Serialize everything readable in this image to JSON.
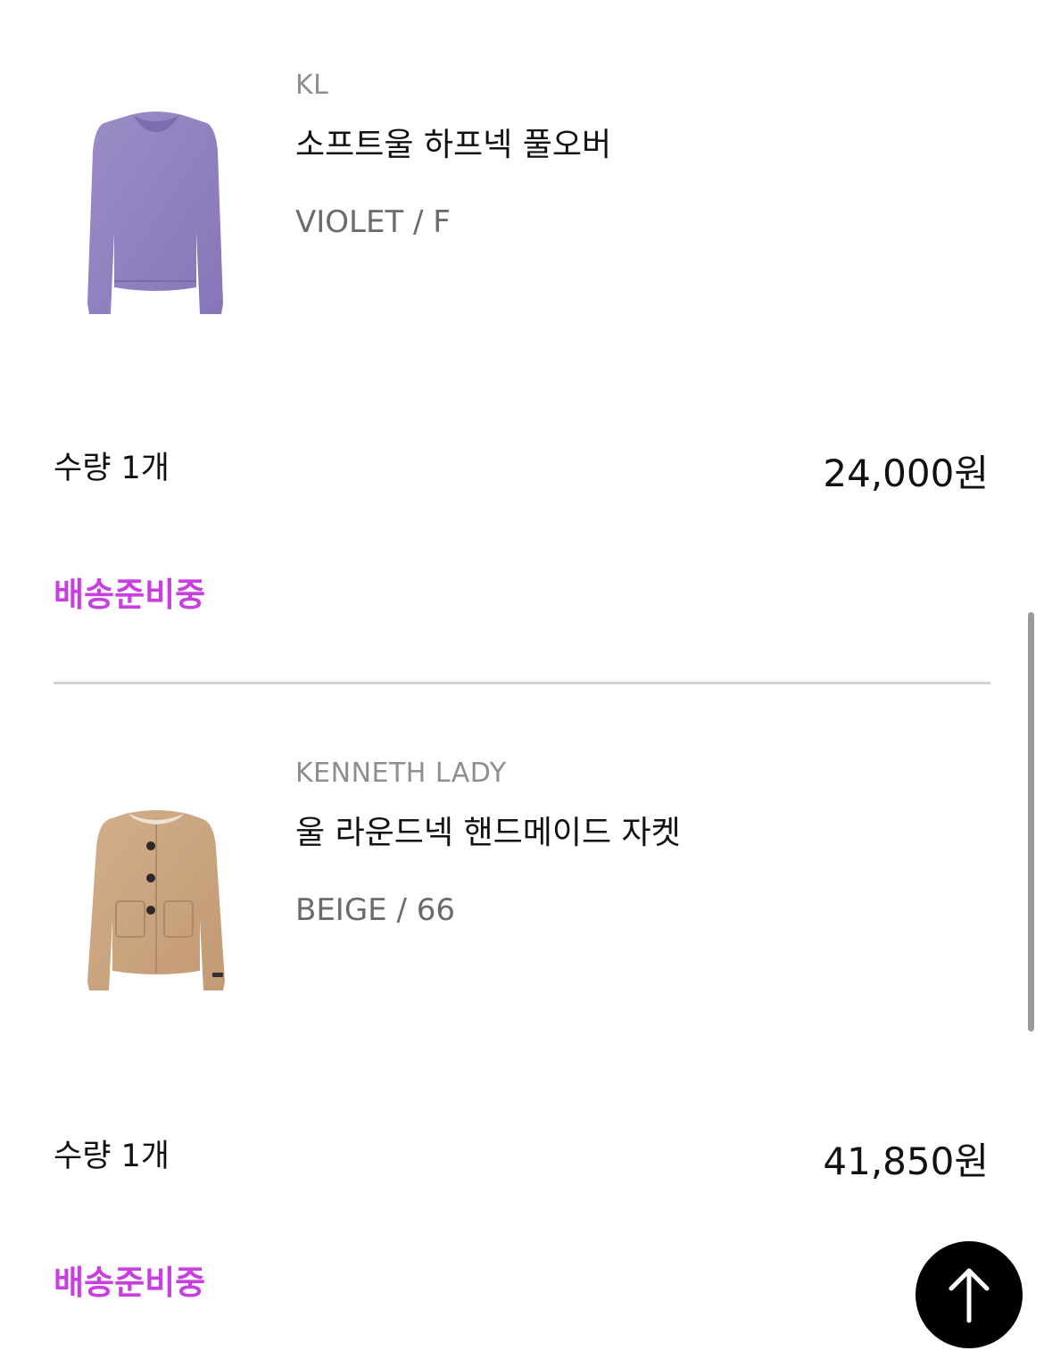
{
  "items": [
    {
      "brand": "KL",
      "name": "소프트울 하프넥 풀오버",
      "option": "VIOLET / F",
      "quantity": "수량 1개",
      "price": "24,000원",
      "status": "배송준비중",
      "image": "violet-sweater"
    },
    {
      "brand": "KENNETH LADY",
      "name": "울 라운드넥 핸드메이드 자켓",
      "option": "BEIGE / 66",
      "quantity": "수량 1개",
      "price": "41,850원",
      "status": "배송준비중",
      "image": "beige-jacket"
    }
  ],
  "colors": {
    "status": "#c93ee0",
    "divider": "#d4d4d4",
    "brand": "#8e8e8e"
  },
  "scroll_top_button": {
    "icon": "arrow-up-icon"
  }
}
